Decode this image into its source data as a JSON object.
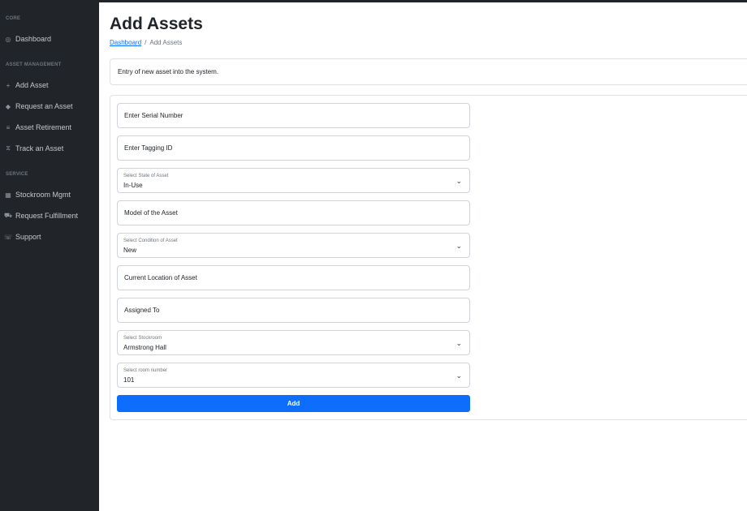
{
  "sidebar": {
    "sections": [
      {
        "heading": "CORE",
        "items": [
          {
            "label": "Dashboard",
            "icon": "dashboard-icon",
            "glyph": "◎"
          }
        ]
      },
      {
        "heading": "ASSET MANAGEMENT",
        "items": [
          {
            "label": "Add Asset",
            "icon": "plus-icon",
            "glyph": "+"
          },
          {
            "label": "Request an Asset",
            "icon": "tag-icon",
            "glyph": "◆"
          },
          {
            "label": "Asset Retirement",
            "icon": "list-icon",
            "glyph": "≡"
          },
          {
            "label": "Track an Asset",
            "icon": "hourglass-icon",
            "glyph": "⧖"
          }
        ]
      },
      {
        "heading": "SERVICE",
        "items": [
          {
            "label": "Stockroom Mgmt",
            "icon": "grid-icon",
            "glyph": "▦"
          },
          {
            "label": "Request Fulfillment",
            "icon": "cart-icon",
            "glyph": "⛟"
          },
          {
            "label": "Support",
            "icon": "support-icon",
            "glyph": "☏"
          }
        ]
      }
    ]
  },
  "header": {
    "title": "Add Assets",
    "breadcrumb": {
      "link": "Dashboard",
      "separator": "/",
      "current": "Add Assets"
    }
  },
  "description": "Entry of new asset into the system.",
  "form": {
    "serial_placeholder": "Enter Serial Number",
    "tagging_placeholder": "Enter Tagging ID",
    "state_select": {
      "label": "Select State of Asset",
      "value": "In-Use"
    },
    "model_placeholder": "Model of the Asset",
    "condition_select": {
      "label": "Select Condition of Asset",
      "value": "New"
    },
    "location_placeholder": "Current Location of Asset",
    "assigned_placeholder": "Assigned To",
    "stockroom_select": {
      "label": "Select Stockroom",
      "value": "Armstrong Hall"
    },
    "room_select": {
      "label": "Select room number",
      "value": "101"
    },
    "submit_label": "Add"
  },
  "colors": {
    "sidebar": "#212529",
    "primary": "#0d6efd",
    "border": "#dee2e6"
  }
}
